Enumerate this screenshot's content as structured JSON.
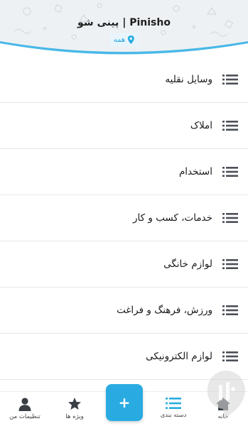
{
  "header": {
    "title": "پینی شو | Pinisho",
    "location_label": "همه",
    "location_icon": "location-pin-icon",
    "accent": "#29abe2"
  },
  "categories": [
    {
      "label": "وسایل نقلیه",
      "icon": "menu-lines-icon"
    },
    {
      "label": "املاک",
      "icon": "menu-lines-icon"
    },
    {
      "label": "استخدام",
      "icon": "menu-lines-icon"
    },
    {
      "label": "خدمات، کسب و کار",
      "icon": "menu-lines-icon"
    },
    {
      "label": "لوازم خانگی",
      "icon": "menu-lines-icon"
    },
    {
      "label": "ورزش، فرهنگ و فراغت",
      "icon": "menu-lines-icon"
    },
    {
      "label": "لوازم الکترونیکی",
      "icon": "menu-lines-icon"
    }
  ],
  "bottom_nav": {
    "items": [
      {
        "label": "تنظیمات من",
        "icon": "user-icon"
      },
      {
        "label": "ویژه ها",
        "icon": "star-icon"
      },
      {
        "label": "دسته بندی",
        "icon": "list-icon",
        "active_color": "#29abe2"
      },
      {
        "label": "خانه",
        "icon": "home-icon"
      }
    ],
    "fab": {
      "label": "+",
      "icon": "plus-icon",
      "color": "#29abe2"
    }
  }
}
